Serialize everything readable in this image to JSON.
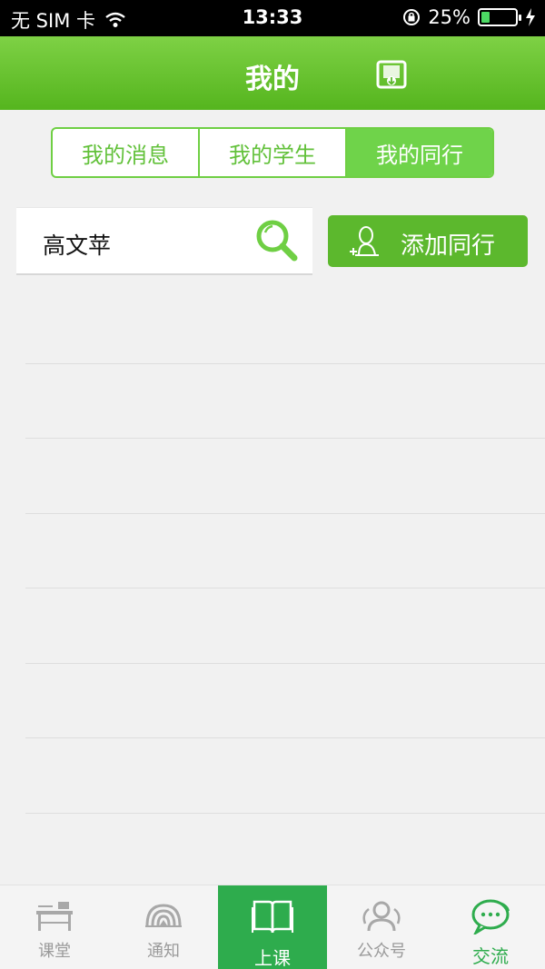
{
  "status_bar": {
    "carrier": "无 SIM 卡",
    "time": "13:33",
    "battery_percent": "25%",
    "battery_level": 0.25
  },
  "header": {
    "title": "我的"
  },
  "segments": [
    {
      "label": "我的消息",
      "active": false
    },
    {
      "label": "我的学生",
      "active": false
    },
    {
      "label": "我的同行",
      "active": true
    }
  ],
  "search": {
    "value": "高文苹"
  },
  "add_button": {
    "label": "添加同行"
  },
  "tabs": [
    {
      "label": "课堂",
      "icon": "desk-icon"
    },
    {
      "label": "通知",
      "icon": "broadcast-icon"
    },
    {
      "label": "上课",
      "icon": "book-icon"
    },
    {
      "label": "公众号",
      "icon": "people-icon"
    },
    {
      "label": "交流",
      "icon": "chat-icon"
    }
  ],
  "colors": {
    "brand_green": "#5cb82d",
    "tab_green": "#2eac4d",
    "segment_active": "#6fd34a"
  }
}
